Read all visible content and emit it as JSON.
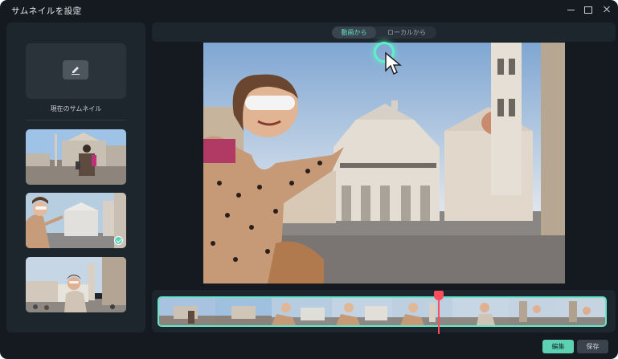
{
  "window": {
    "title": "サムネイルを設定"
  },
  "left_panel": {
    "current_thumbnail_label": "現在のサムネイル",
    "thumbnails": [
      {
        "name": "piazza-woman-backpack"
      },
      {
        "name": "selfie-woman-sunglasses",
        "selected": true
      },
      {
        "name": "woman-street-buildings"
      }
    ]
  },
  "source_tabs": {
    "from_video": "動画から",
    "from_local": "ローカルから",
    "active": "from_video"
  },
  "footer": {
    "edit_label": "編集",
    "save_label": "保存"
  },
  "colors": {
    "accent": "#5fd3b8",
    "playhead": "#ff4c5b",
    "background": "#141a20",
    "panel": "#1d252d"
  },
  "icons": [
    "info-icon",
    "minimize-icon",
    "maximize-icon",
    "close-icon",
    "pencil-icon",
    "check-icon",
    "cursor-icon"
  ]
}
